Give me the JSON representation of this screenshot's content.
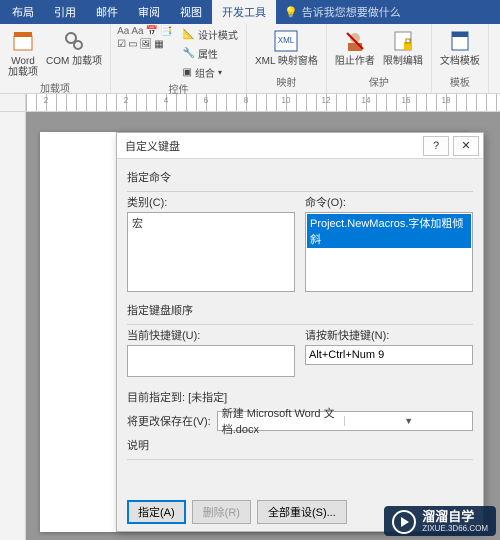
{
  "ribbon": {
    "tabs": [
      "布局",
      "引用",
      "邮件",
      "审阅",
      "视图",
      "开发工具"
    ],
    "activeTabIndex": 5,
    "tellMe": "告诉我您想要做什么",
    "groups": {
      "addins": {
        "word": "Word\n加载项",
        "com": "COM 加载项",
        "label": "加载项"
      },
      "controls": {
        "designMode": "设计模式",
        "properties": "属性",
        "group": "组合",
        "label": "控件"
      },
      "mapping": {
        "xml": "XML 映射窗格",
        "label": "映射"
      },
      "protect": {
        "block": "阻止作者",
        "restrict": "限制编辑",
        "label": "保护"
      },
      "template": {
        "doc": "文档模板",
        "label": "模板"
      }
    }
  },
  "ruler": {
    "nums": [
      "2",
      "",
      "2",
      "4",
      "6",
      "8",
      "10",
      "12",
      "14",
      "16",
      "18"
    ]
  },
  "dialog": {
    "title": "自定义键盘",
    "help": "?",
    "close": "✕",
    "specifyCmd": "指定命令",
    "categoryLabel": "类别(C):",
    "categoryItem": "宏",
    "commandLabel": "命令(O):",
    "commandItem": "Project.NewMacros.字体加粗倾斜",
    "keySeq": "指定键盘顺序",
    "currentKeysLabel": "当前快捷键(U):",
    "newKeyLabel": "请按新快捷键(N):",
    "newKeyValue": "Alt+Ctrl+Num 9",
    "assignedTo": "目前指定到:  [未指定]",
    "saveInLabel": "将更改保存在(V):",
    "saveInValue": "新建 Microsoft Word 文档.docx",
    "descLabel": "说明",
    "btnAssign": "指定(A)",
    "btnRemove": "删除(R)",
    "btnReset": "全部重设(S)..."
  },
  "watermark": {
    "name": "溜溜自学",
    "url": "ZIXUE.3D66.COM"
  }
}
